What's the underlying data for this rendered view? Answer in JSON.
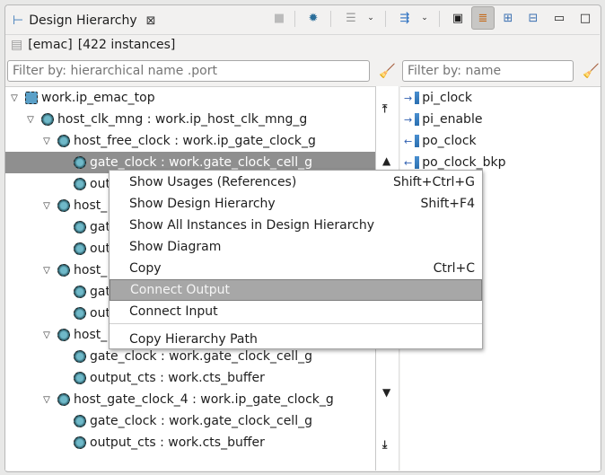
{
  "view": {
    "title": "Design Hierarchy",
    "info_name": "[emac]",
    "info_count": "[422 instances]"
  },
  "filters": {
    "hier_placeholder": "Filter by: hierarchical name .port",
    "name_placeholder": "Filter by: name"
  },
  "tree": [
    {
      "label": "work.ip_emac_top",
      "depth": 0,
      "expanded": true
    },
    {
      "label": "host_clk_mng : work.ip_host_clk_mng_g",
      "depth": 1,
      "expanded": true
    },
    {
      "label": "host_free_clock : work.ip_gate_clock_g",
      "depth": 2,
      "expanded": true
    },
    {
      "label": "gate_clock : work.gate_clock_cell_g",
      "depth": 3,
      "selected": true
    },
    {
      "label": "out",
      "depth": 3
    },
    {
      "label": "host_",
      "depth": 2,
      "expanded": true
    },
    {
      "label": "gat",
      "depth": 3
    },
    {
      "label": "out",
      "depth": 3
    },
    {
      "label": "host_",
      "depth": 2,
      "expanded": true
    },
    {
      "label": "gat",
      "depth": 3
    },
    {
      "label": "out",
      "depth": 3
    },
    {
      "label": "host_",
      "depth": 2,
      "expanded": true
    },
    {
      "label": "gate_clock : work.gate_clock_cell_g",
      "depth": 3
    },
    {
      "label": "output_cts : work.cts_buffer",
      "depth": 3
    },
    {
      "label": "host_gate_clock_4 : work.ip_gate_clock_g",
      "depth": 2,
      "expanded": true
    },
    {
      "label": "gate_clock : work.gate_clock_cell_g",
      "depth": 3
    },
    {
      "label": "output_cts : work.cts_buffer",
      "depth": 3
    }
  ],
  "ports": [
    {
      "label": "pi_clock",
      "dir": "in"
    },
    {
      "label": "pi_enable",
      "dir": "in"
    },
    {
      "label": "po_clock",
      "dir": "out"
    },
    {
      "label": "po_clock_bkp",
      "dir": "out"
    }
  ],
  "menu": [
    {
      "label": "Show Usages (References)",
      "shortcut": "Shift+Ctrl+G"
    },
    {
      "label": "Show Design Hierarchy",
      "shortcut": "Shift+F4"
    },
    {
      "label": "Show All Instances in Design Hierarchy",
      "shortcut": ""
    },
    {
      "label": "Show Diagram",
      "shortcut": ""
    },
    {
      "label": "Copy",
      "shortcut": "Ctrl+C"
    },
    {
      "label": "Connect Output",
      "shortcut": "",
      "highlighted": true
    },
    {
      "label": "Connect Input",
      "shortcut": ""
    },
    {
      "label": "Copy Hierarchy Path",
      "shortcut": "",
      "after_separator": true
    }
  ],
  "toolbar": [
    "stop-icon",
    "bug-icon",
    "list-icon",
    "dropdown-icon",
    "sort-columns-icon",
    "dropdown-icon",
    "chip-icon",
    "layers-icon",
    "expand-all-icon",
    "collapse-all-icon",
    "minimize-icon",
    "maximize-icon"
  ]
}
